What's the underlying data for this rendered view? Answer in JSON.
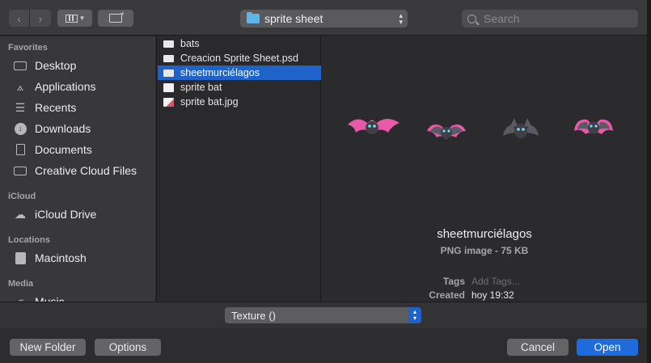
{
  "toolbar": {
    "back_icon": "chevron-left-icon",
    "forward_icon": "chevron-right-icon",
    "view_icon": "column-view-icon",
    "new_folder_icon": "new-folder-icon",
    "location": "sprite sheet",
    "search_placeholder": "Search"
  },
  "sidebar": {
    "sections": {
      "favorites": "Favorites",
      "icloud": "iCloud",
      "locations": "Locations",
      "media": "Media"
    },
    "favorites": [
      {
        "label": "Desktop",
        "icon": "desktop-icon"
      },
      {
        "label": "Applications",
        "icon": "applications-icon"
      },
      {
        "label": "Recents",
        "icon": "recents-icon"
      },
      {
        "label": "Downloads",
        "icon": "downloads-icon"
      },
      {
        "label": "Documents",
        "icon": "documents-icon"
      },
      {
        "label": "Creative Cloud Files",
        "icon": "folder-icon"
      }
    ],
    "icloud": [
      {
        "label": "iCloud Drive",
        "icon": "cloud-icon"
      }
    ],
    "locations": [
      {
        "label": "Macintosh",
        "icon": "disk-icon"
      }
    ],
    "media": [
      {
        "label": "Music",
        "icon": "music-icon"
      }
    ]
  },
  "files": [
    {
      "name": "bats",
      "selected": false
    },
    {
      "name": "Creacion Sprite Sheet.psd",
      "selected": false
    },
    {
      "name": "sheetmurciélagos",
      "selected": true
    },
    {
      "name": "sprite bat",
      "selected": false
    },
    {
      "name": "sprite bat.jpg",
      "selected": false
    }
  ],
  "preview": {
    "name": "sheetmurciélagos",
    "kind": "PNG image - 75 KB",
    "tags_label": "Tags",
    "tags_placeholder": "Add Tags...",
    "created_label": "Created",
    "created_value": "hoy 19:32"
  },
  "format": {
    "selected": "Texture ()"
  },
  "buttons": {
    "new_folder": "New Folder",
    "options": "Options",
    "cancel": "Cancel",
    "open": "Open"
  },
  "colors": {
    "accent": "#1d63c9",
    "bat_wing": "#e85aa8",
    "bat_body": "#3f3f45"
  }
}
